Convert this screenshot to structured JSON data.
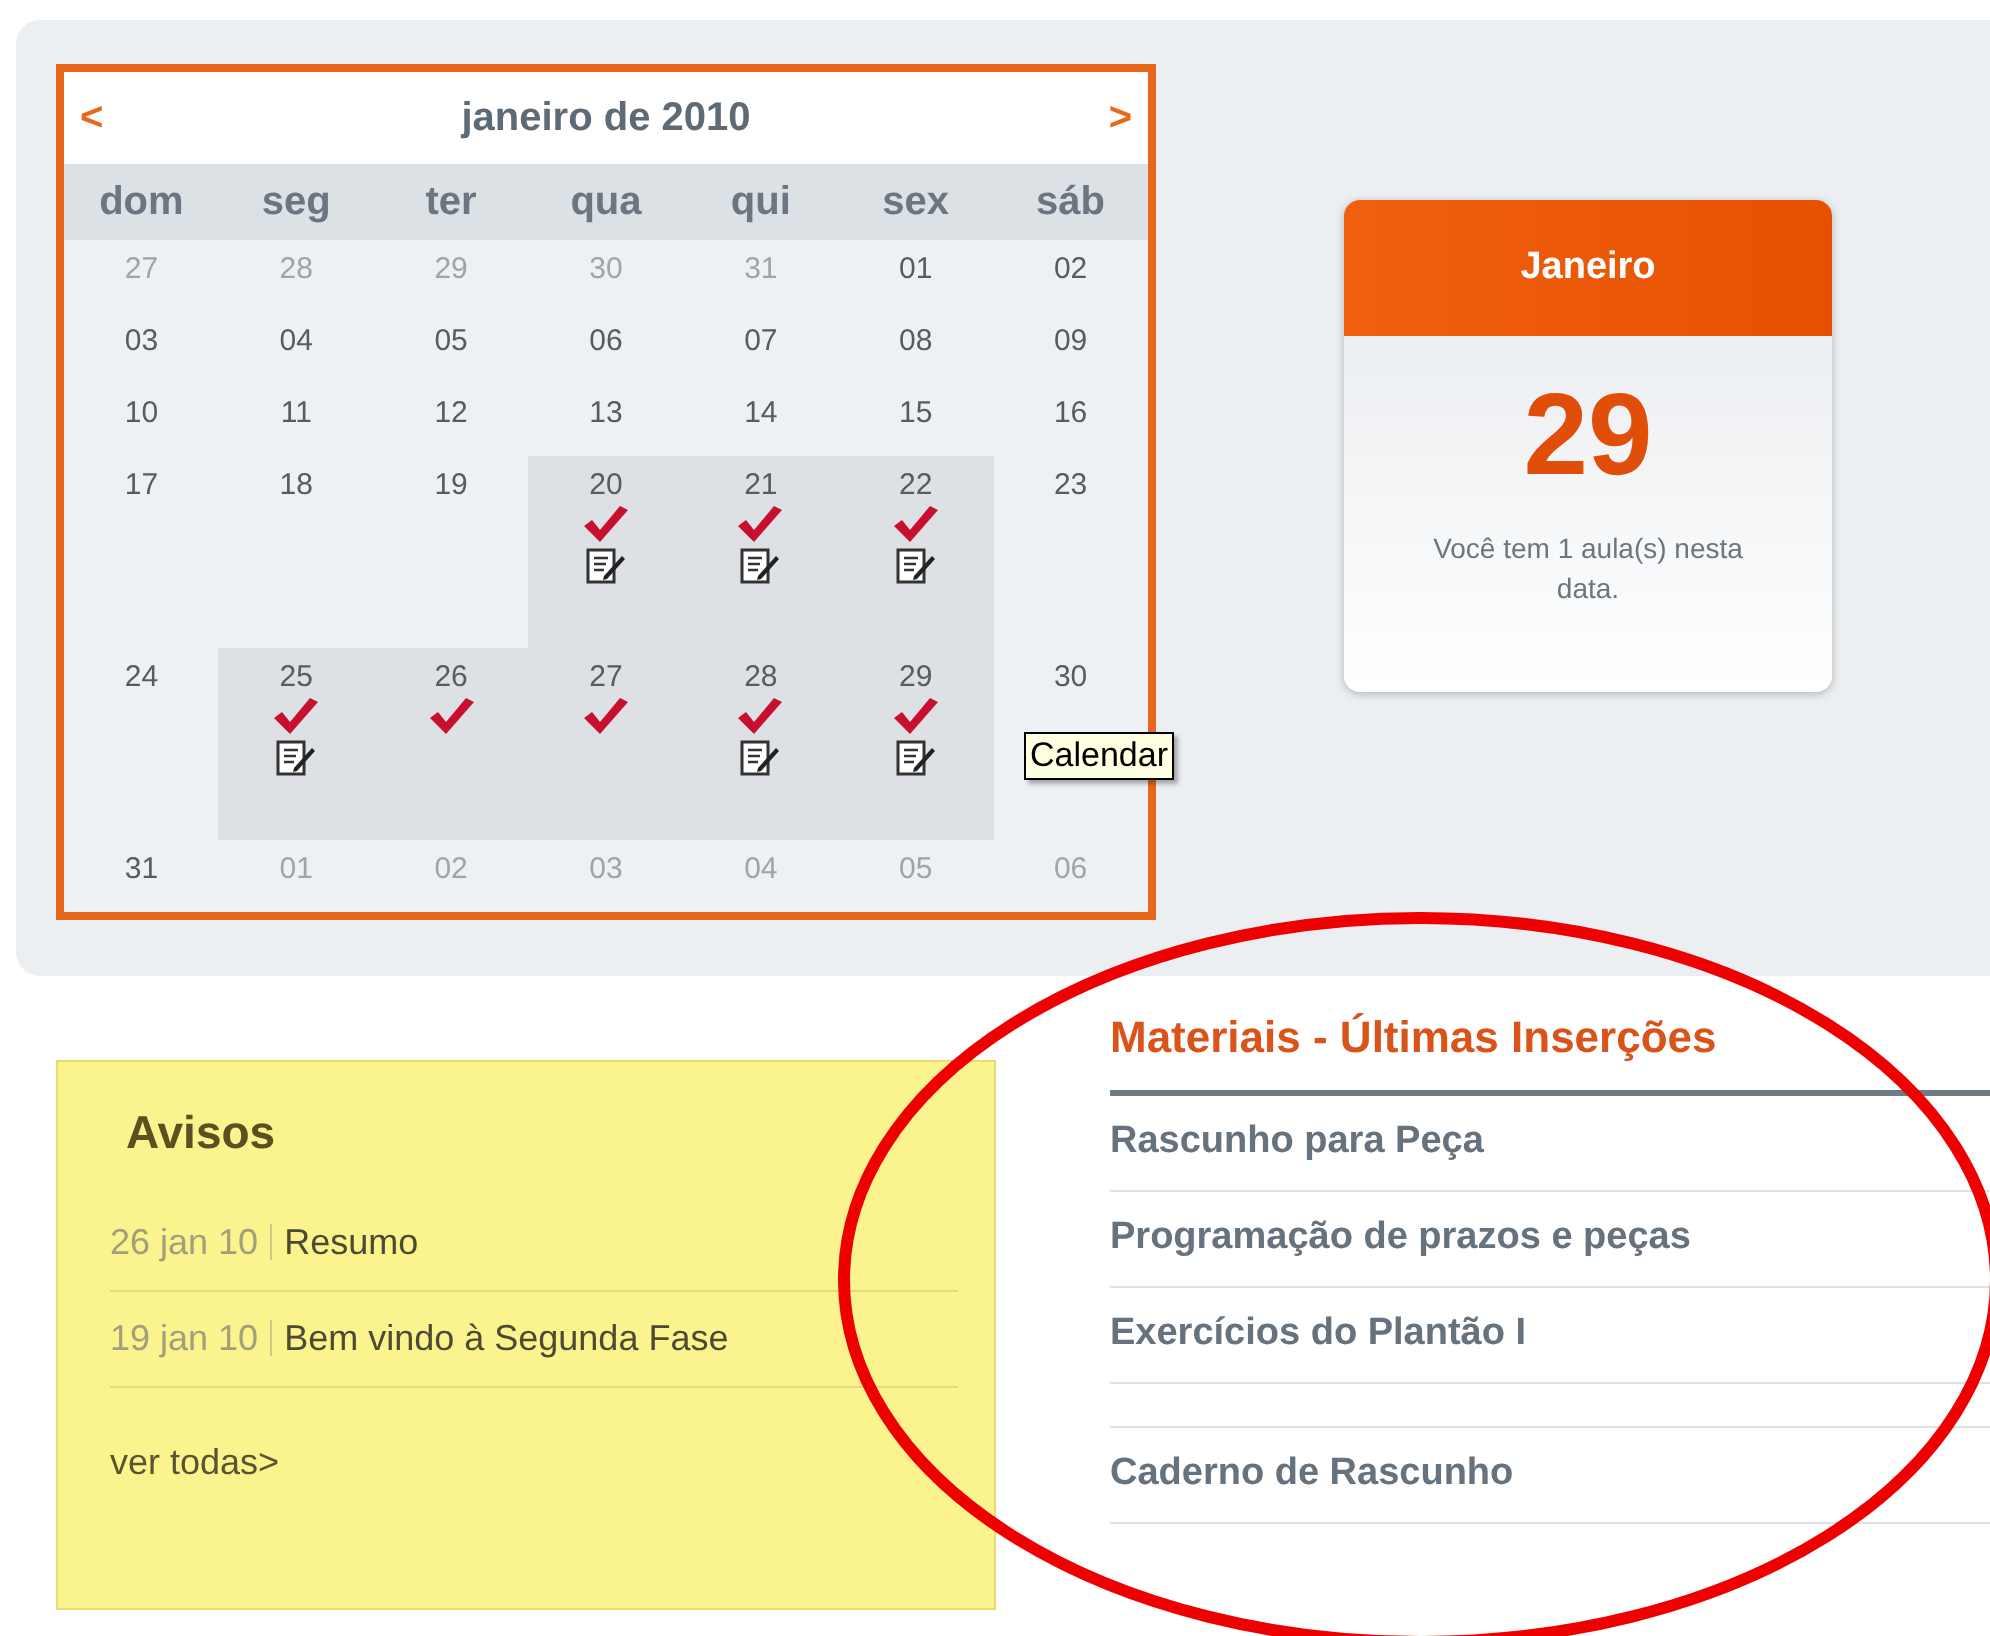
{
  "calendar": {
    "prev": "<",
    "next": ">",
    "title": "janeiro de 2010",
    "weekdays": [
      "dom",
      "seg",
      "ter",
      "qua",
      "qui",
      "sex",
      "sáb"
    ],
    "weeks": [
      [
        {
          "day": "27",
          "outside": true,
          "highlighted": false,
          "checked": false,
          "note": false
        },
        {
          "day": "28",
          "outside": true,
          "highlighted": false,
          "checked": false,
          "note": false
        },
        {
          "day": "29",
          "outside": true,
          "highlighted": false,
          "checked": false,
          "note": false
        },
        {
          "day": "30",
          "outside": true,
          "highlighted": false,
          "checked": false,
          "note": false
        },
        {
          "day": "31",
          "outside": true,
          "highlighted": false,
          "checked": false,
          "note": false
        },
        {
          "day": "01",
          "outside": false,
          "highlighted": false,
          "checked": false,
          "note": false
        },
        {
          "day": "02",
          "outside": false,
          "highlighted": false,
          "checked": false,
          "note": false
        }
      ],
      [
        {
          "day": "03",
          "outside": false,
          "highlighted": false,
          "checked": false,
          "note": false
        },
        {
          "day": "04",
          "outside": false,
          "highlighted": false,
          "checked": false,
          "note": false
        },
        {
          "day": "05",
          "outside": false,
          "highlighted": false,
          "checked": false,
          "note": false
        },
        {
          "day": "06",
          "outside": false,
          "highlighted": false,
          "checked": false,
          "note": false
        },
        {
          "day": "07",
          "outside": false,
          "highlighted": false,
          "checked": false,
          "note": false
        },
        {
          "day": "08",
          "outside": false,
          "highlighted": false,
          "checked": false,
          "note": false
        },
        {
          "day": "09",
          "outside": false,
          "highlighted": false,
          "checked": false,
          "note": false
        }
      ],
      [
        {
          "day": "10",
          "outside": false,
          "highlighted": false,
          "checked": false,
          "note": false
        },
        {
          "day": "11",
          "outside": false,
          "highlighted": false,
          "checked": false,
          "note": false
        },
        {
          "day": "12",
          "outside": false,
          "highlighted": false,
          "checked": false,
          "note": false
        },
        {
          "day": "13",
          "outside": false,
          "highlighted": false,
          "checked": false,
          "note": false
        },
        {
          "day": "14",
          "outside": false,
          "highlighted": false,
          "checked": false,
          "note": false
        },
        {
          "day": "15",
          "outside": false,
          "highlighted": false,
          "checked": false,
          "note": false
        },
        {
          "day": "16",
          "outside": false,
          "highlighted": false,
          "checked": false,
          "note": false
        }
      ],
      [
        {
          "day": "17",
          "outside": false,
          "highlighted": false,
          "checked": false,
          "note": false
        },
        {
          "day": "18",
          "outside": false,
          "highlighted": false,
          "checked": false,
          "note": false
        },
        {
          "day": "19",
          "outside": false,
          "highlighted": false,
          "checked": false,
          "note": false
        },
        {
          "day": "20",
          "outside": false,
          "highlighted": true,
          "checked": true,
          "note": true
        },
        {
          "day": "21",
          "outside": false,
          "highlighted": true,
          "checked": true,
          "note": true
        },
        {
          "day": "22",
          "outside": false,
          "highlighted": true,
          "checked": true,
          "note": true
        },
        {
          "day": "23",
          "outside": false,
          "highlighted": false,
          "checked": false,
          "note": false
        }
      ],
      [
        {
          "day": "24",
          "outside": false,
          "highlighted": false,
          "checked": false,
          "note": false
        },
        {
          "day": "25",
          "outside": false,
          "highlighted": true,
          "checked": true,
          "note": true
        },
        {
          "day": "26",
          "outside": false,
          "highlighted": true,
          "checked": true,
          "note": false
        },
        {
          "day": "27",
          "outside": false,
          "highlighted": true,
          "checked": true,
          "note": false
        },
        {
          "day": "28",
          "outside": false,
          "highlighted": true,
          "checked": true,
          "note": true
        },
        {
          "day": "29",
          "outside": false,
          "highlighted": true,
          "checked": true,
          "note": true
        },
        {
          "day": "30",
          "outside": false,
          "highlighted": false,
          "checked": false,
          "note": false
        }
      ],
      [
        {
          "day": "31",
          "outside": false,
          "highlighted": false,
          "checked": false,
          "note": false
        },
        {
          "day": "01",
          "outside": true,
          "highlighted": false,
          "checked": false,
          "note": false
        },
        {
          "day": "02",
          "outside": true,
          "highlighted": false,
          "checked": false,
          "note": false
        },
        {
          "day": "03",
          "outside": true,
          "highlighted": false,
          "checked": false,
          "note": false
        },
        {
          "day": "04",
          "outside": true,
          "highlighted": false,
          "checked": false,
          "note": false
        },
        {
          "day": "05",
          "outside": true,
          "highlighted": false,
          "checked": false,
          "note": false
        },
        {
          "day": "06",
          "outside": true,
          "highlighted": false,
          "checked": false,
          "note": false
        }
      ]
    ],
    "tooltip": "Calendar"
  },
  "date_card": {
    "month": "Janeiro",
    "day": "29",
    "message": "Você tem 1 aula(s) nesta data."
  },
  "notices": {
    "title": "Avisos",
    "items": [
      {
        "date": "26 jan 10",
        "title": "Resumo"
      },
      {
        "date": "19 jan 10",
        "title": "Bem vindo à Segunda Fase"
      }
    ],
    "more": "ver todas>"
  },
  "materials": {
    "title": "Materiais - Últimas Inserções",
    "items": [
      {
        "kind": "link",
        "label": "Rascunho para Peça"
      },
      {
        "kind": "link",
        "label": "Programação de prazos e peças"
      },
      {
        "kind": "link",
        "label": "Exercícios do Plantão I"
      },
      {
        "kind": "spacer"
      },
      {
        "kind": "link",
        "label": "Caderno de Rascunho"
      }
    ]
  }
}
